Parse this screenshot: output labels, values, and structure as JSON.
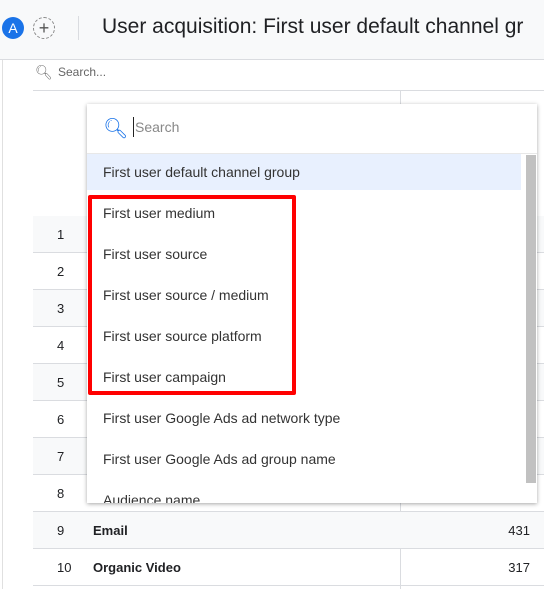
{
  "header": {
    "avatar": "A",
    "add_icon": "+",
    "title": "User acquisition: First user default channel gr"
  },
  "table": {
    "search_placeholder": "Search...",
    "rows": [
      {
        "n": "1",
        "label": "",
        "value": ""
      },
      {
        "n": "2",
        "label": "",
        "value": ""
      },
      {
        "n": "3",
        "label": "",
        "value": ""
      },
      {
        "n": "4",
        "label": "",
        "value": ""
      },
      {
        "n": "5",
        "label": "",
        "value": ""
      },
      {
        "n": "6",
        "label": "",
        "value": ""
      },
      {
        "n": "7",
        "label": "",
        "value": ""
      },
      {
        "n": "8",
        "label": "",
        "value": ""
      },
      {
        "n": "9",
        "label": "Email",
        "value": "431"
      },
      {
        "n": "10",
        "label": "Organic Video",
        "value": "317"
      }
    ]
  },
  "dropdown": {
    "search_placeholder": "Search",
    "items": [
      "First user default channel group",
      "First user medium",
      "First user source",
      "First user source / medium",
      "First user source platform",
      "First user campaign",
      "First user Google Ads ad network type",
      "First user Google Ads ad group name",
      "Audience name"
    ],
    "selected_index": 0,
    "highlight_color": "#ff0000"
  }
}
